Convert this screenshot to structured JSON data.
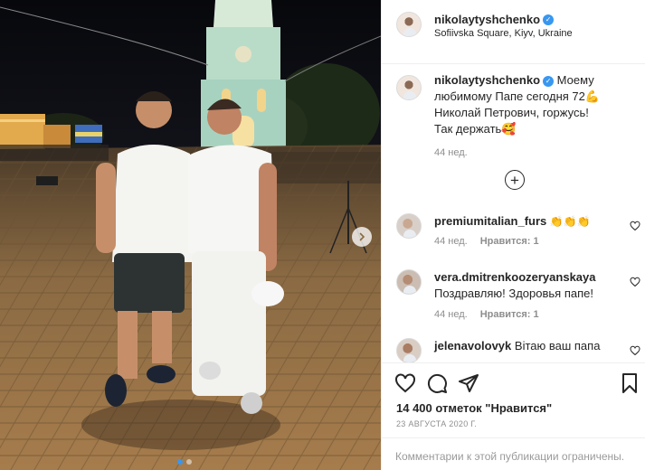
{
  "post": {
    "username": "nikolaytyshchenko",
    "location": "Sofiivska Square, Kiyv, Ukraine",
    "caption_lines": [
      "Моему",
      "любимому Папе сегодня 72",
      "Николай Петрович, горжусь!",
      "Так держать"
    ],
    "caption_age": "44 нед.",
    "carousel": {
      "total": 2,
      "active": 1
    }
  },
  "comments": [
    {
      "username": "premiumitalian_furs",
      "text": "👏👏👏",
      "age": "44 нед.",
      "likes": "Нравится: 1"
    },
    {
      "username": "vera.dmitrenkoozeryanskaya",
      "text": "Поздравляю! Здоровья папе!",
      "age": "44 нед.",
      "likes": "Нравится: 1"
    },
    {
      "username": "jelenavolovyk",
      "text": "Вітаю ваш папа",
      "age": "",
      "likes": ""
    }
  ],
  "stats": {
    "likes": "14 400 отметок \"Нравится\"",
    "date": "23 АВГУСТА 2020 Г."
  },
  "footer": {
    "limited_text": "Комментарии к этой публикации ограничены."
  },
  "icons": {
    "verified": "verified-badge-icon",
    "like": "heart-icon",
    "comment": "comment-icon",
    "share": "paper-plane-icon",
    "save": "bookmark-icon",
    "load_more": "plus-circle-icon",
    "next": "chevron-right-icon"
  },
  "colors": {
    "accent": "#3897f0",
    "text": "#262626",
    "secondary": "#8e8e8e",
    "border": "#efefef"
  }
}
